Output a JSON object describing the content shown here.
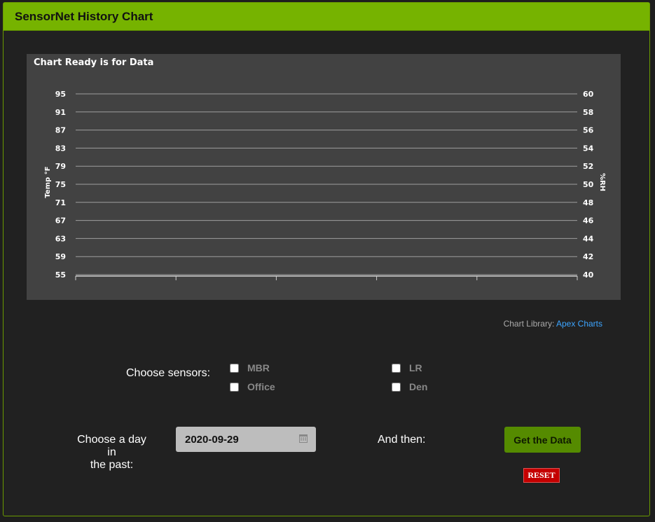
{
  "header": {
    "title": "SensorNet History Chart"
  },
  "chart": {
    "title": "Chart Ready is for Data",
    "y_left_label": "Temp °F",
    "y_right_label": "%RH",
    "y_left_ticks": [
      "95",
      "91",
      "87",
      "83",
      "79",
      "75",
      "71",
      "67",
      "63",
      "59",
      "55"
    ],
    "y_right_ticks": [
      "60",
      "58",
      "56",
      "54",
      "52",
      "50",
      "48",
      "46",
      "44",
      "42",
      "40"
    ],
    "grid_color": "#9e9e9e",
    "background": "#424242"
  },
  "chart_data": {
    "type": "line",
    "title": "Chart Ready is for Data",
    "ylabel": "Temp °F",
    "y2label": "%RH",
    "ylim": [
      55,
      95
    ],
    "y2lim": [
      40,
      60
    ],
    "series": [],
    "grid": true
  },
  "library": {
    "prefix": "Chart Library:",
    "link_text": "Apex Charts"
  },
  "sensors": {
    "label": "Choose sensors:",
    "items": [
      {
        "name": "MBR",
        "checked": false
      },
      {
        "name": "Office",
        "checked": false
      },
      {
        "name": "LR",
        "checked": false
      },
      {
        "name": "Den",
        "checked": false
      }
    ]
  },
  "date": {
    "label_line1": "Choose a day in",
    "label_line2": "the past:",
    "value": "2020-09-29"
  },
  "actions": {
    "and_then": "And then:",
    "get_label": "Get the Data",
    "reset_label": "RESET"
  },
  "colors": {
    "header": "#76b300",
    "get_button": "#558b00",
    "reset_button": "#c40000",
    "link": "#3da5ff"
  }
}
